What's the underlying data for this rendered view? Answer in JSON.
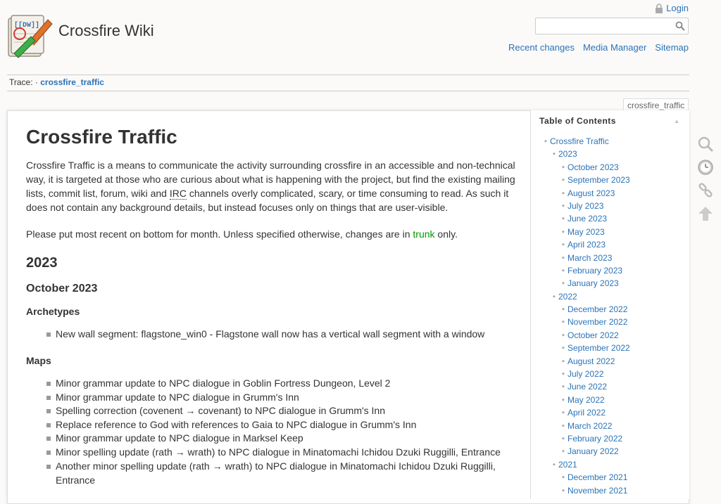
{
  "header": {
    "site_title": "Crossfire Wiki",
    "logo_text": "[[DW]]",
    "login_label": "Login",
    "search": {
      "placeholder": "",
      "value": ""
    },
    "tools": [
      "Recent changes",
      "Media Manager",
      "Sitemap"
    ]
  },
  "trace": {
    "label": "Trace:",
    "separator": "·",
    "link": "crossfire_traffic"
  },
  "page_id": "crossfire_traffic",
  "content": {
    "title": "Crossfire Traffic",
    "intro_before": "Crossfire Traffic is a means to communicate the activity surrounding crossfire in an accessible and non-technical way, it is targeted at those who are curious about what is happening with the project, but find the existing mailing lists, commit list, forum, wiki and ",
    "intro_abbr": "IRC",
    "intro_after": " channels overly complicated, scary, or time consuming to read. As such it does not contain any background details, but instead focuses only on things that are user-visible.",
    "note_before": "Please put most recent on bottom for month. Unless specified otherwise, changes are in ",
    "note_link": "trunk",
    "note_after": " only.",
    "year_heading": "2023",
    "month_heading": "October 2023",
    "archetypes_heading": "Archetypes",
    "archetypes": [
      "New wall segment: flagstone_win0 - Flagstone wall now has a vertical wall segment with a window"
    ],
    "maps_heading": "Maps",
    "maps": [
      "Minor grammar update to NPC dialogue in Goblin Fortress Dungeon, Level 2",
      "Minor grammar update to NPC dialogue in Grumm's Inn",
      "Spelling correction (covenent → covenant) to NPC dialogue in Grumm's Inn",
      "Replace reference to God with references to Gaia to NPC dialogue in Grumm's Inn",
      "Minor grammar update to NPC dialogue in Marksel Keep",
      "Minor spelling update (rath → wrath) to NPC dialogue in Minatomachi Ichidou Dzuki Ruggilli, Entrance",
      "Another minor spelling update (rath → wrath) to NPC dialogue in Minatomachi Ichidou Dzuki Ruggilli, Entrance"
    ]
  },
  "toc": {
    "title": "Table of Contents",
    "items": [
      {
        "label": "Crossfire Traffic",
        "level": 1
      },
      {
        "label": "2023",
        "level": 2
      },
      {
        "label": "October 2023",
        "level": 3
      },
      {
        "label": "September 2023",
        "level": 3
      },
      {
        "label": "August 2023",
        "level": 3
      },
      {
        "label": "July 2023",
        "level": 3
      },
      {
        "label": "June 2023",
        "level": 3
      },
      {
        "label": "May 2023",
        "level": 3
      },
      {
        "label": "April 2023",
        "level": 3
      },
      {
        "label": "March 2023",
        "level": 3
      },
      {
        "label": "February 2023",
        "level": 3
      },
      {
        "label": "January 2023",
        "level": 3
      },
      {
        "label": "2022",
        "level": 2
      },
      {
        "label": "December 2022",
        "level": 3
      },
      {
        "label": "November 2022",
        "level": 3
      },
      {
        "label": "October 2022",
        "level": 3
      },
      {
        "label": "September 2022",
        "level": 3
      },
      {
        "label": "August 2022",
        "level": 3
      },
      {
        "label": "July 2022",
        "level": 3
      },
      {
        "label": "June 2022",
        "level": 3
      },
      {
        "label": "May 2022",
        "level": 3
      },
      {
        "label": "April 2022",
        "level": 3
      },
      {
        "label": "March 2022",
        "level": 3
      },
      {
        "label": "February 2022",
        "level": 3
      },
      {
        "label": "January 2022",
        "level": 3
      },
      {
        "label": "2021",
        "level": 2
      },
      {
        "label": "December 2021",
        "level": 3
      },
      {
        "label": "November 2021",
        "level": 3
      }
    ]
  },
  "page_tools": [
    {
      "icon": "search-page-icon"
    },
    {
      "icon": "old-revisions-icon"
    },
    {
      "icon": "backlinks-icon"
    },
    {
      "icon": "back-to-top-icon"
    }
  ],
  "colors": {
    "link": "#2b73b7",
    "trunk_link": "#009900",
    "text": "#333333"
  }
}
